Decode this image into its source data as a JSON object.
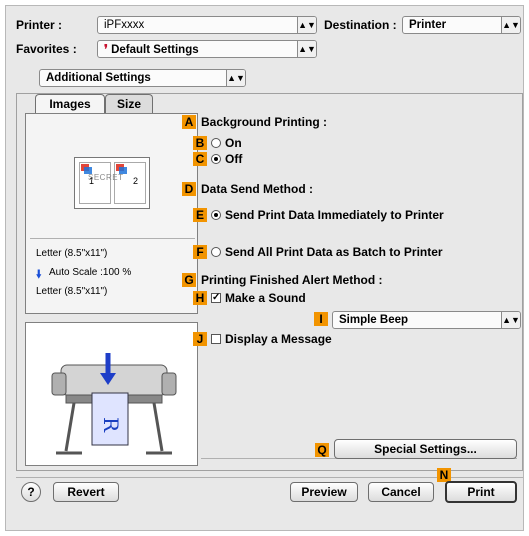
{
  "printer": {
    "label": "Printer :",
    "value": "iPFxxxx"
  },
  "destination": {
    "label": "Destination :",
    "value": "Printer"
  },
  "favorites": {
    "label": "Favorites :",
    "value": "Default Settings"
  },
  "panel_select": {
    "value": "Additional Settings"
  },
  "tabs": [
    {
      "label": "Images"
    },
    {
      "label": "Size"
    }
  ],
  "preview": {
    "page_text": "SECRET",
    "page_left_num": "1",
    "page_right_num": "2",
    "info_line1": "Letter (8.5\"x11\")",
    "info_line2": "Auto Scale :100 %",
    "info_line3": "Letter (8.5\"x11\")"
  },
  "markers": {
    "A": "A",
    "B": "B",
    "C": "C",
    "D": "D",
    "E": "E",
    "F": "F",
    "G": "G",
    "H": "H",
    "I": "I",
    "J": "J",
    "Q": "Q",
    "N": "N"
  },
  "background_printing": {
    "title": "Background Printing :",
    "on_label": "On",
    "off_label": "Off",
    "selected": "Off"
  },
  "data_send": {
    "title": "Data Send Method :",
    "option_immediate": "Send Print Data Immediately to Printer",
    "option_batch": "Send All Print Data as Batch to Printer",
    "selected": "immediate"
  },
  "alert": {
    "title": "Printing Finished Alert Method :",
    "sound_label": "Make a Sound",
    "sound_checked": true,
    "sound_value": "Simple Beep",
    "message_label": "Display a Message",
    "message_checked": false
  },
  "buttons": {
    "special_settings": "Special Settings...",
    "help": "?",
    "revert": "Revert",
    "preview": "Preview",
    "cancel": "Cancel",
    "print": "Print"
  }
}
